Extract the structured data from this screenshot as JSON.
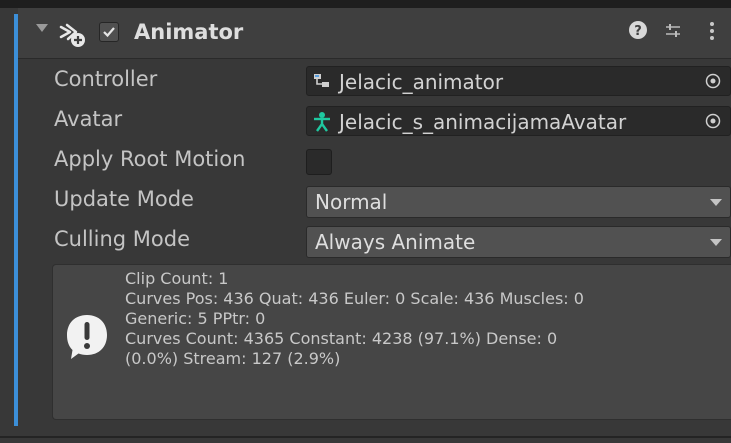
{
  "component": {
    "title": "Animator",
    "icon": "animator-icon",
    "enabled": true,
    "header_icons": [
      "help-icon",
      "preset-icon",
      "kebab-menu-icon"
    ]
  },
  "fields": {
    "controller": {
      "label": "Controller",
      "value": "Jelacic_animator",
      "icon": "animator-controller-icon"
    },
    "avatar": {
      "label": "Avatar",
      "value": "Jelacic_s_animacijamaAvatar",
      "icon": "avatar-icon"
    },
    "apply_root_motion": {
      "label": "Apply Root Motion",
      "checked": false
    },
    "update_mode": {
      "label": "Update Mode",
      "value": "Normal"
    },
    "culling_mode": {
      "label": "Culling Mode",
      "value": "Always Animate"
    }
  },
  "info": {
    "icon": "info-icon",
    "lines": [
      "Clip Count: 1",
      "Curves Pos: 436 Quat: 436 Euler: 0 Scale: 436 Muscles: 0",
      "Generic: 5 PPtr: 0",
      "Curves Count: 4365 Constant: 4238 (97.1%) Dense: 0",
      "(0.0%) Stream: 127 (2.9%)"
    ]
  },
  "colors": {
    "background": "#383838",
    "accent": "#3c8fd8",
    "field": "#2a2a2a",
    "dropdown": "#515151",
    "avatar_icon": "#1fc8a0"
  }
}
